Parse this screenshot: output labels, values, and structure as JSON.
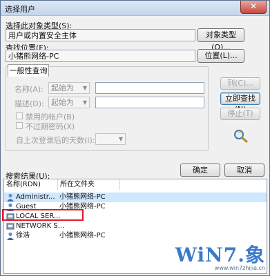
{
  "window": {
    "title": "选择用户",
    "close_glyph": "✕"
  },
  "object_type": {
    "label": "选择此对象类型(S):",
    "value": "用户或内置安全主体",
    "button": "对象类型(O)..."
  },
  "location": {
    "label": "查找位置(F):",
    "value": "小猪熊网络-PC",
    "button": "位置(L)..."
  },
  "general_query": {
    "tab": "一般性查询",
    "name_label": "名称(A):",
    "name_mode": "起始为",
    "desc_label": "描述(D):",
    "desc_mode": "起始为",
    "disabled_accounts": "禁用的帐户(B)",
    "no_expire_pw": "不过期密码(X)",
    "days_since_login": "自上次登录后的天数(I):"
  },
  "buttons": {
    "columns": "列(C)...",
    "find_now": "立即查找(N)",
    "stop": "停止(T)",
    "ok": "确定",
    "cancel": "取消"
  },
  "results": {
    "label": "搜索结果(U):",
    "headers": [
      "名称(RDN)",
      "所在文件夹"
    ],
    "rows": [
      {
        "name": "Administr...",
        "folder": "小猪熊网络-PC",
        "icon": "user-icon",
        "selected": true
      },
      {
        "name": "Guest",
        "folder": "小猪熊网络-PC",
        "icon": "user-icon"
      },
      {
        "name": "LOCAL SER...",
        "folder": "",
        "icon": "service-icon"
      },
      {
        "name": "NETWORK S...",
        "folder": "",
        "icon": "service-icon"
      },
      {
        "name": "徐浩",
        "folder": "小猪熊网络-PC",
        "icon": "user-icon"
      }
    ]
  },
  "watermark": {
    "brand": "WiN7.象",
    "url": "www.win7zhijia.cn"
  }
}
